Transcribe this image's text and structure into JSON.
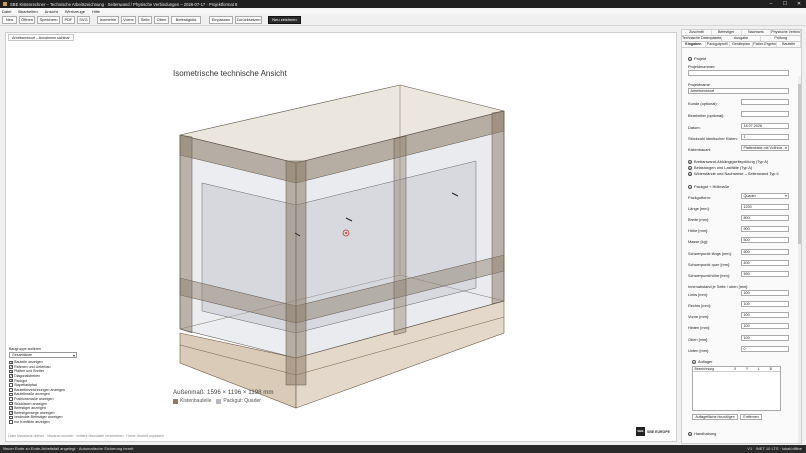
{
  "window": {
    "title": "SBE Kistenrechner – Technische Arbeitszeichnung · Seitenwand / Physische Verbindungen – 2026-07-17 · Projektformat 8",
    "controls": {
      "minimize": "–",
      "maximize": "☐",
      "close": "✕"
    }
  },
  "menu": [
    "Datei",
    "Bearbeiten",
    "Ansicht",
    "Werkzeuge",
    "Hilfe"
  ],
  "toolbar": {
    "new": "Neu",
    "open": "Öffnen",
    "save": "Speichern",
    "pdf": "PDF",
    "svg": "SVG",
    "isometric": "Isometrie",
    "front": "Vorne",
    "side": "Seite",
    "top": "Oben",
    "render": "Befestigbild",
    "fit": "Einpassen",
    "reset": "Zurücksetzen",
    "redraw": "Neu zeichnen"
  },
  "viewport": {
    "tab": "Arbeitsentwurf – Annahmen sichtbar",
    "heading": "Isometrische technische Ansicht",
    "dims": "Außenmaß: 1596 × 1196 × 1198 mm",
    "legend": [
      {
        "label": "Kistenbauteile",
        "color": "#8a7a66"
      },
      {
        "label": "Packgut: Quader",
        "color": "#b9b9c4"
      }
    ],
    "hint": "Linke Maustaste drehen · Mausrad zoomen · mittlere Maustaste verschieben · Home: Ansicht anpassen",
    "logo_text": "SBE EUROPE",
    "logo_badge": "SBE"
  },
  "component_group": {
    "label": "Baugruppe isolieren",
    "selected": "Gesamtkiste",
    "items": [
      {
        "label": "Bauteile anzeigen",
        "checked": true
      },
      {
        "label": "Rahmen und Unterbau",
        "checked": true
      },
      {
        "label": "Platten und Bretter",
        "checked": true
      },
      {
        "label": "Diagonalstreben",
        "checked": true
      },
      {
        "label": "Packgut",
        "checked": true
      },
      {
        "label": "Stapellastpfad",
        "checked": false
      },
      {
        "label": "Bauteilbezeichnungen anzeigen",
        "checked": false
      },
      {
        "label": "Bauteilmaße anzeigen",
        "checked": false
      },
      {
        "label": "Positionsmaße anzeigen",
        "checked": false
      },
      {
        "label": "Stücklisten anzeigen",
        "checked": false
      },
      {
        "label": "Befestiger anzeigen",
        "checked": true
      },
      {
        "label": "Befestigerwege anzeigen",
        "checked": true
      },
      {
        "label": "verdeckte Befestiger anzeigen",
        "checked": false
      },
      {
        "label": "nur Konflikte anzeigen",
        "checked": false
      }
    ]
  },
  "panel": {
    "tabs_row1": [
      "Zuschnitt",
      "Befestiger",
      "Nachweis",
      "Physische Verbindungen"
    ],
    "tabs_row2": [
      "Technische Datenpakete",
      "Ausgabe",
      "Prüfung"
    ],
    "tabs_row3": [
      "Eingaben",
      "Packgutprofil",
      "Geräteplan",
      "Fixtier-Ergebnis",
      "Bauteile"
    ],
    "project": {
      "section": "Projekt",
      "number_label": "Projektnummer:",
      "number_value": "",
      "name_label": "Projektname:",
      "name_value": "Arbeitsentwurf",
      "customer_label": "Kunde (optional):",
      "customer_value": "",
      "editor_label": "Bearbeiter (optional):",
      "editor_value": "",
      "date_label": "Datum:",
      "date_value": "18.07.2026",
      "count_label": "Stückzahl identischer Kisten:",
      "count_value": "1",
      "type_label": "Kistenbauart:",
      "type_value": "Plattenkiste mit Vollholz…"
    },
    "collapsed": [
      "Brettanwand-Abhängigkeitsprüfung (Typ A)",
      "Belastungen und Lastfälle (Typ A)",
      "Widerstände und Nachweise – Seitenwand Typ 6"
    ],
    "packgut": {
      "section": "Packgut + Hüllmaße",
      "form_label": "Packgutform:",
      "form_value": "Quader",
      "length_label": "Länge [mm]:",
      "length_value": "1200",
      "width_label": "Breite [mm]:",
      "width_value": "800",
      "height_label": "Höhe [mm]:",
      "height_value": "900",
      "mass_label": "Masse [kg]:",
      "mass_value": "500",
      "cgl_label": "Schwerpunkt längs [mm]:",
      "cgl_value": "600",
      "cgq_label": "Schwerpunkt quer [mm]:",
      "cgq_value": "400",
      "cgh_label": "Schwerpunkthöhe [mm]:",
      "cgh_value": "450",
      "inner_label": "Innenabstand je Seite / oben [mm]:",
      "left_label": "Links [mm]:",
      "left_value": "100",
      "right_label": "Rechts [mm]:",
      "right_value": "100",
      "front_label": "Vorne [mm]:",
      "front_value": "100",
      "back_label": "Hinten [mm]:",
      "back_value": "100",
      "top_label": "Oben [mm]:",
      "top_value": "100",
      "bottom_label": "Unten [mm]:",
      "bottom_value": "0"
    },
    "supports": {
      "section": "Auflager",
      "columns": [
        "Bezeichnung",
        "X",
        "Y",
        "L",
        "B"
      ],
      "add_button": "Auflagefläche hinzufügen",
      "remove_button": "Entfernen"
    },
    "handling": "Handhabung"
  },
  "status": {
    "left": "Neuer Ende zu Ende-Arbeitsfall angelegt · Automatische Sicherung bereit",
    "right": "V1 · INET 10 LTS · lokal/offline"
  }
}
